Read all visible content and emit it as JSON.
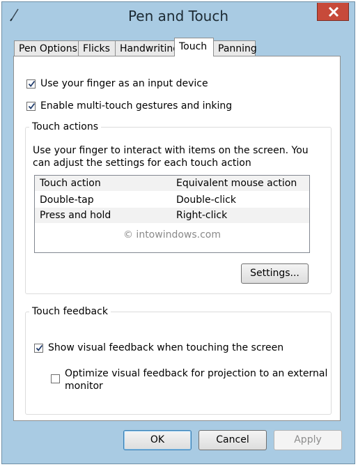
{
  "window": {
    "title": "Pen and Touch"
  },
  "tabs": [
    {
      "label": "Pen Options"
    },
    {
      "label": "Flicks"
    },
    {
      "label": "Handwriting"
    },
    {
      "label": "Touch"
    },
    {
      "label": "Panning"
    }
  ],
  "active_tab": "Touch",
  "options": {
    "finger_input": {
      "label": "Use your finger as an input device",
      "checked": true
    },
    "multitouch": {
      "label": "Enable multi-touch gestures and inking",
      "checked": true
    }
  },
  "touch_actions": {
    "legend": "Touch actions",
    "description_line1": "Use your finger to interact with items on the screen. You",
    "description_line2": "can adjust the settings for each touch action",
    "columns": [
      "Touch action",
      "Equivalent mouse action"
    ],
    "rows": [
      [
        "Double-tap",
        "Double-click"
      ],
      [
        "Press and hold",
        "Right-click"
      ]
    ],
    "watermark": "© intowindows.com",
    "settings_label": "Settings..."
  },
  "touch_feedback": {
    "legend": "Touch feedback",
    "show_visual": {
      "label": "Show visual feedback when touching the screen",
      "checked": true
    },
    "optimize": {
      "label_line1": "Optimize visual feedback for projection to an external",
      "label_line2": "monitor",
      "checked": false
    }
  },
  "buttons": {
    "ok": "OK",
    "cancel": "Cancel",
    "apply": "Apply"
  }
}
